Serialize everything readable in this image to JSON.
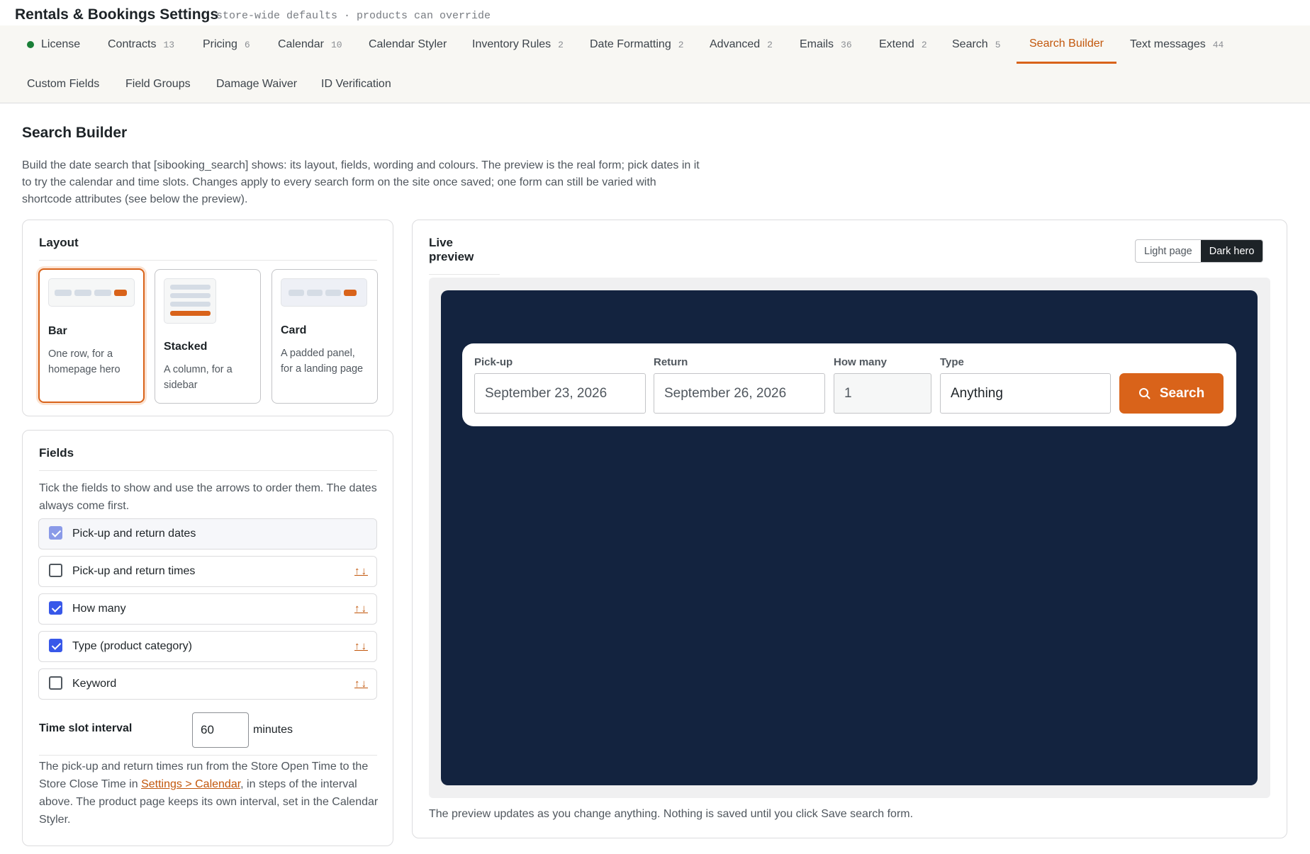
{
  "app": {
    "title": "Rentals & Bookings Settings",
    "subtitle": "store-wide defaults · products can override"
  },
  "tabs": [
    {
      "label": "License",
      "count": ""
    },
    {
      "label": "Contracts",
      "count": "13"
    },
    {
      "label": "Pricing",
      "count": "6"
    },
    {
      "label": "Calendar",
      "count": "10"
    },
    {
      "label": "Calendar Styler",
      "count": ""
    },
    {
      "label": "Inventory Rules",
      "count": "2"
    },
    {
      "label": "Date Formatting",
      "count": "2"
    },
    {
      "label": "Advanced",
      "count": "2"
    },
    {
      "label": "Emails",
      "count": "36"
    },
    {
      "label": "Extend",
      "count": "2"
    },
    {
      "label": "Search",
      "count": "5"
    },
    {
      "label": "Search Builder",
      "count": ""
    },
    {
      "label": "Text messages",
      "count": "44"
    },
    {
      "label": "Custom Fields",
      "count": ""
    },
    {
      "label": "Field Groups",
      "count": ""
    },
    {
      "label": "Damage Waiver",
      "count": ""
    },
    {
      "label": "ID Verification",
      "count": ""
    }
  ],
  "active_tab": "Search Builder",
  "page": {
    "title": "Search Builder",
    "description": "Build the date search that [sibooking_search] shows: its layout, fields, wording and colours. The preview is the real form; pick dates in it to try the calendar and time slots. Changes apply to every search form on the site once saved; one form can still be varied with shortcode attributes (see below the preview)."
  },
  "layout": {
    "title": "Layout",
    "options": [
      {
        "name": "Bar",
        "desc": "One row, for a homepage hero",
        "selected": true
      },
      {
        "name": "Stacked",
        "desc": "A column, for a sidebar",
        "selected": false
      },
      {
        "name": "Card",
        "desc": "A padded panel, for a landing page",
        "selected": false
      }
    ]
  },
  "fields": {
    "title": "Fields",
    "help": "Tick the fields to show and use the arrows to order them. The dates always come first.",
    "items": [
      {
        "label": "Pick-up and return dates",
        "checked": true,
        "locked": true
      },
      {
        "label": "Pick-up and return times",
        "checked": false,
        "arrows": "↑↓"
      },
      {
        "label": "How many",
        "checked": true,
        "arrows": "↑↓"
      },
      {
        "label": "Type (product category)",
        "checked": true,
        "arrows": "↑↓"
      },
      {
        "label": "Keyword",
        "checked": false,
        "arrows": "↑↓"
      }
    ],
    "interval_label": "Time slot interval",
    "interval_value": "60",
    "interval_unit": "minutes",
    "interval_help_pre": "The pick-up and return times run from the Store Open Time to the Store Close Time in ",
    "interval_help_link": "Settings > Calendar",
    "interval_help_post": ", in steps of the interval above. The product page keeps its own interval, set in the Calendar Styler."
  },
  "preview": {
    "title": "Live preview",
    "toggle": {
      "light": "Light page",
      "dark": "Dark hero",
      "active": "dark"
    },
    "form": {
      "pickup_label": "Pick-up",
      "pickup_value": "September 23, 2026",
      "return_label": "Return",
      "return_value": "September 26, 2026",
      "qty_label": "How many",
      "qty_value": "1",
      "type_label": "Type",
      "type_value": "Anything",
      "button": "Search"
    },
    "note": "The preview updates as you change anything. Nothing is saved until you click Save search form."
  },
  "colors": {
    "accent": "#d9631a",
    "hero_bg": "#13233f",
    "checkbox": "#3858e9"
  }
}
